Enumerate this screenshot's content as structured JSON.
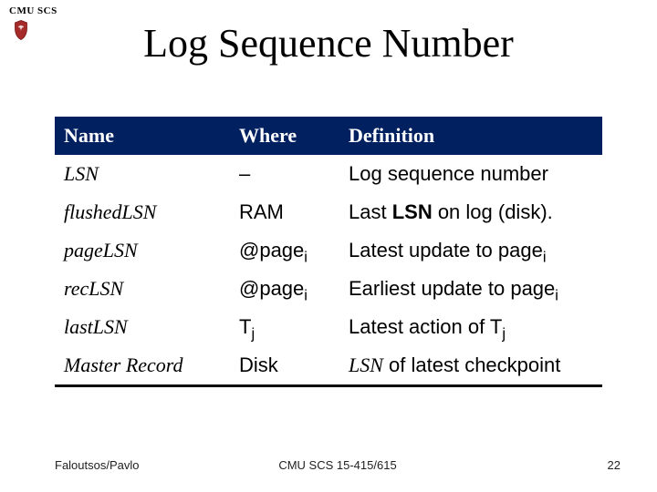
{
  "header": {
    "org": "CMU SCS"
  },
  "title": "Log Sequence Number",
  "table": {
    "columns": [
      "Name",
      "Where",
      "Definition"
    ],
    "rows": [
      {
        "name": "LSN",
        "where_plain": "–",
        "def_plain": "Log sequence number"
      },
      {
        "name": "flushedLSN",
        "where_plain": "RAM",
        "def_pre": "Last ",
        "def_mid_bold": "LSN",
        "def_post": " on log (disk)."
      },
      {
        "name": "pageLSN",
        "where_pre": "@page",
        "where_sub": "i",
        "def_pre": "Latest update to page",
        "def_sub": "i"
      },
      {
        "name": "recLSN",
        "where_pre": "@page",
        "where_sub": "i",
        "def_pre": "Earliest update to page",
        "def_sub": "i"
      },
      {
        "name": "lastLSN",
        "where_pre": "T",
        "where_sub": "j",
        "def_pre": "Latest action of T",
        "def_sub": "j"
      },
      {
        "name": "Master Record",
        "where_plain": "Disk",
        "def_pre_ital": "LSN",
        "def_post": " of latest checkpoint"
      }
    ]
  },
  "footer": {
    "left": "Faloutsos/Pavlo",
    "center": "CMU SCS 15-415/615",
    "page": "22"
  }
}
